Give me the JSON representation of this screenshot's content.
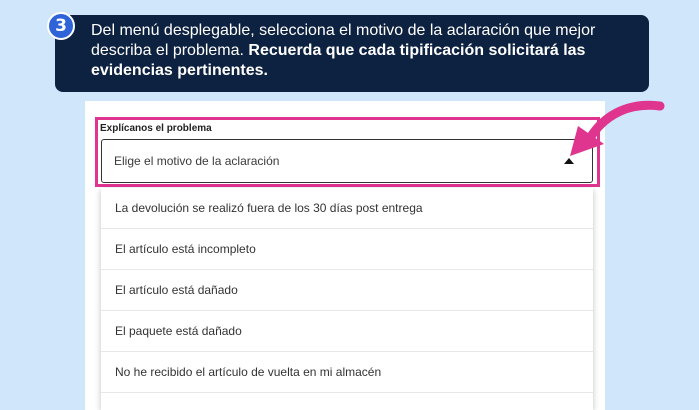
{
  "step": {
    "number": "3",
    "text_normal": "Del menú desplegable, selecciona el motivo de la aclaración que mejor describa el problema. ",
    "text_bold": "Recuerda que cada tipificación solicitará las evidencias pertinentes."
  },
  "form": {
    "label": "Explícanos el problema",
    "select_placeholder": "Elige el motivo de la aclaración",
    "options": [
      "La devolución se realizó fuera de los 30 días post entrega",
      "El artículo está incompleto",
      "El artículo está dañado",
      "El paquete está dañado",
      "No he recibido el artículo de vuelta en mi almacén"
    ]
  },
  "colors": {
    "banner": "#0d2140",
    "badge": "#2f63d8",
    "highlight": "#e0358f",
    "background": "#cfe6fb"
  },
  "icons": {
    "caret": "caret-up-icon",
    "pointer": "arrow-pointer-icon"
  }
}
